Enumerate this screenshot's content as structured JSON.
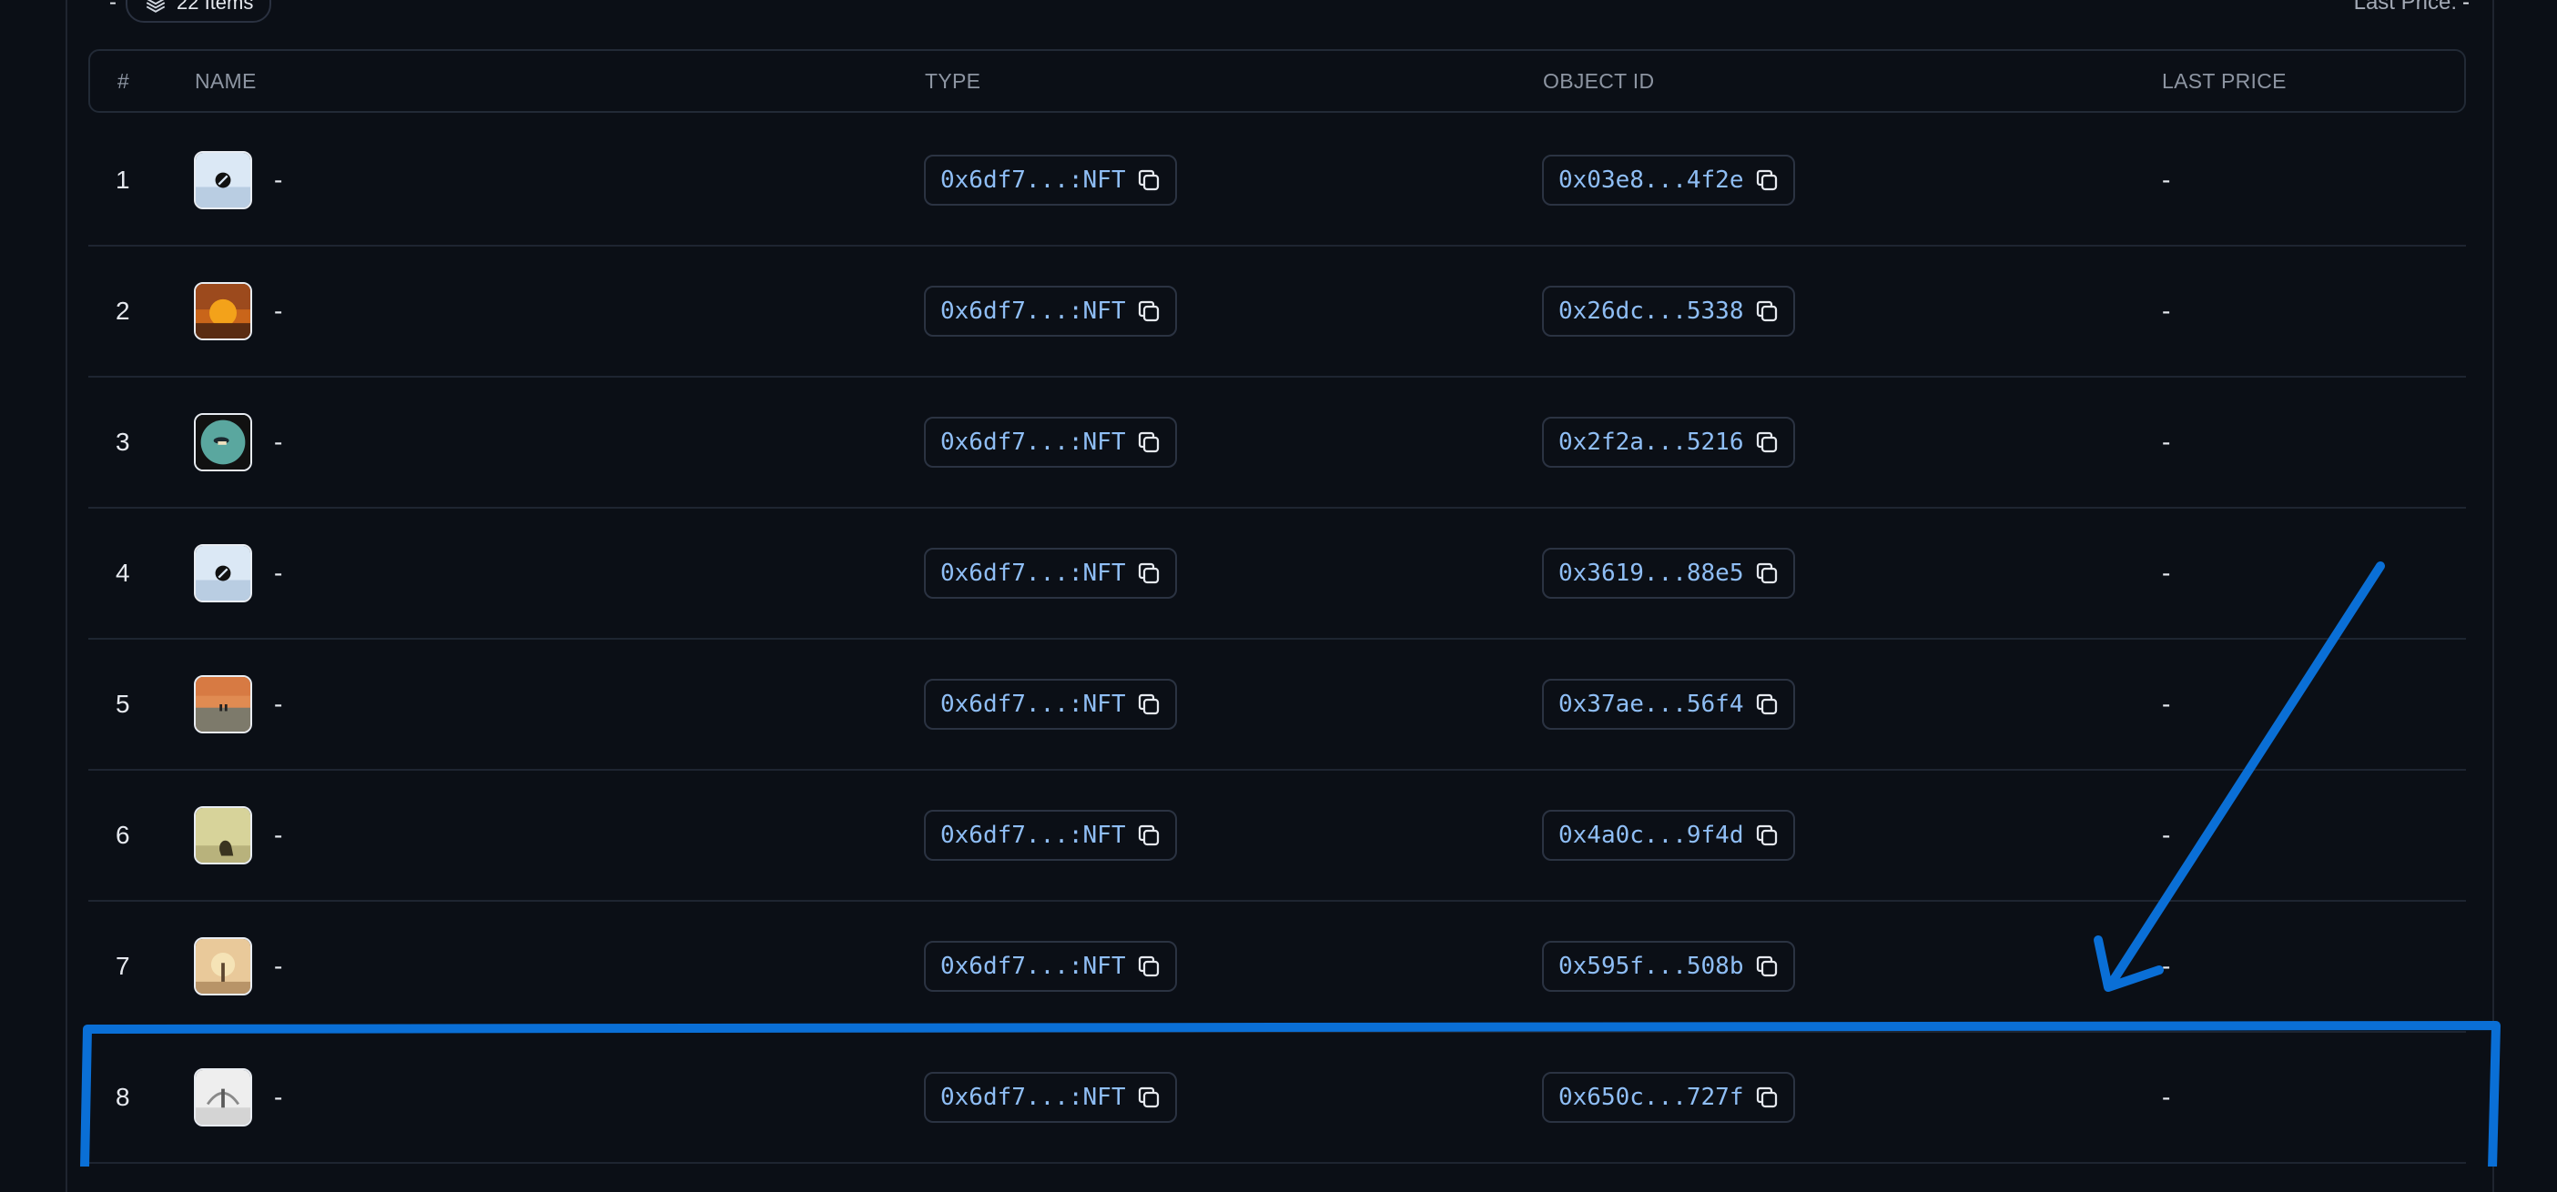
{
  "toolbar": {
    "leading_dash": "-",
    "items_count": "22 Items",
    "last_price_label": "Last Price:",
    "last_price_value": "-"
  },
  "table": {
    "headers": [
      "#",
      "NAME",
      "TYPE",
      "OBJECT ID",
      "LAST PRICE"
    ],
    "rows": [
      {
        "index": "1",
        "name": "-",
        "type": "0x6df7...:NFT",
        "object_id": "0x03e8...4f2e",
        "last_price": "-"
      },
      {
        "index": "2",
        "name": "-",
        "type": "0x6df7...:NFT",
        "object_id": "0x26dc...5338",
        "last_price": "-"
      },
      {
        "index": "3",
        "name": "-",
        "type": "0x6df7...:NFT",
        "object_id": "0x2f2a...5216",
        "last_price": "-"
      },
      {
        "index": "4",
        "name": "-",
        "type": "0x6df7...:NFT",
        "object_id": "0x3619...88e5",
        "last_price": "-"
      },
      {
        "index": "5",
        "name": "-",
        "type": "0x6df7...:NFT",
        "object_id": "0x37ae...56f4",
        "last_price": "-"
      },
      {
        "index": "6",
        "name": "-",
        "type": "0x6df7...:NFT",
        "object_id": "0x4a0c...9f4d",
        "last_price": "-"
      },
      {
        "index": "7",
        "name": "-",
        "type": "0x6df7...:NFT",
        "object_id": "0x595f...508b",
        "last_price": "-"
      },
      {
        "index": "8",
        "name": "-",
        "type": "0x6df7...:NFT",
        "object_id": "0x650c...727f",
        "last_price": "-"
      }
    ]
  },
  "icons": {
    "items": "layers-icon",
    "copy": "copy-icon",
    "nft_thumbnail": "nft-thumbnail"
  },
  "colors": {
    "background": "#0b0f16",
    "mono_link": "#8fbef5",
    "annotation": "#0a6fd6"
  }
}
